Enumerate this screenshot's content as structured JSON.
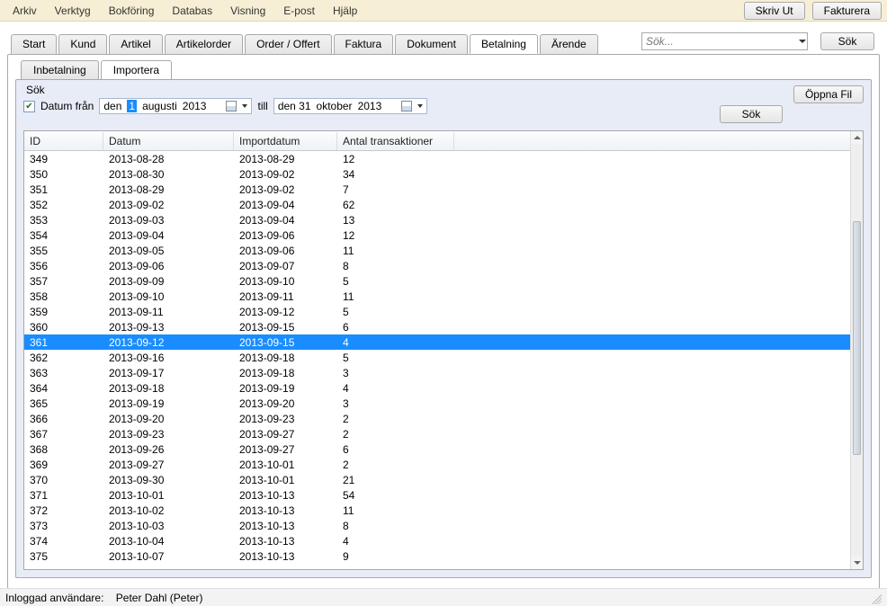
{
  "menu": [
    "Arkiv",
    "Verktyg",
    "Bokföring",
    "Databas",
    "Visning",
    "E-post",
    "Hjälp"
  ],
  "top_buttons": {
    "print": "Skriv Ut",
    "invoice": "Fakturera"
  },
  "search": {
    "placeholder": "Sök...",
    "button": "Sök"
  },
  "main_tabs": [
    "Start",
    "Kund",
    "Artikel",
    "Artikelorder",
    "Order / Offert",
    "Faktura",
    "Dokument",
    "Betalning",
    "Ärende"
  ],
  "main_tab_active": 7,
  "sub_tabs": [
    "Inbetalning",
    "Importera"
  ],
  "sub_tab_active": 1,
  "filter": {
    "title": "Sök",
    "date_from_label": "Datum från",
    "date_from": {
      "day": "den",
      "num": "1",
      "month": "augusti",
      "year": "2013"
    },
    "till_label": "till",
    "date_to": {
      "day": "den 31",
      "month": "oktober",
      "year": "2013"
    },
    "search_btn": "Sök",
    "open_file_btn": "Öppna Fil",
    "checkbox_checked": true
  },
  "columns": [
    "ID",
    "Datum",
    "Importdatum",
    "Antal transaktioner"
  ],
  "selected_row": 12,
  "rows": [
    {
      "id": "349",
      "datum": "2013-08-28",
      "import": "2013-08-29",
      "antal": "12"
    },
    {
      "id": "350",
      "datum": "2013-08-30",
      "import": "2013-09-02",
      "antal": "34"
    },
    {
      "id": "351",
      "datum": "2013-08-29",
      "import": "2013-09-02",
      "antal": "7"
    },
    {
      "id": "352",
      "datum": "2013-09-02",
      "import": "2013-09-04",
      "antal": "62"
    },
    {
      "id": "353",
      "datum": "2013-09-03",
      "import": "2013-09-04",
      "antal": "13"
    },
    {
      "id": "354",
      "datum": "2013-09-04",
      "import": "2013-09-06",
      "antal": "12"
    },
    {
      "id": "355",
      "datum": "2013-09-05",
      "import": "2013-09-06",
      "antal": "11"
    },
    {
      "id": "356",
      "datum": "2013-09-06",
      "import": "2013-09-07",
      "antal": "8"
    },
    {
      "id": "357",
      "datum": "2013-09-09",
      "import": "2013-09-10",
      "antal": "5"
    },
    {
      "id": "358",
      "datum": "2013-09-10",
      "import": "2013-09-11",
      "antal": "11"
    },
    {
      "id": "359",
      "datum": "2013-09-11",
      "import": "2013-09-12",
      "antal": "5"
    },
    {
      "id": "360",
      "datum": "2013-09-13",
      "import": "2013-09-15",
      "antal": "6"
    },
    {
      "id": "361",
      "datum": "2013-09-12",
      "import": "2013-09-15",
      "antal": "4"
    },
    {
      "id": "362",
      "datum": "2013-09-16",
      "import": "2013-09-18",
      "antal": "5"
    },
    {
      "id": "363",
      "datum": "2013-09-17",
      "import": "2013-09-18",
      "antal": "3"
    },
    {
      "id": "364",
      "datum": "2013-09-18",
      "import": "2013-09-19",
      "antal": "4"
    },
    {
      "id": "365",
      "datum": "2013-09-19",
      "import": "2013-09-20",
      "antal": "3"
    },
    {
      "id": "366",
      "datum": "2013-09-20",
      "import": "2013-09-23",
      "antal": "2"
    },
    {
      "id": "367",
      "datum": "2013-09-23",
      "import": "2013-09-27",
      "antal": "2"
    },
    {
      "id": "368",
      "datum": "2013-09-26",
      "import": "2013-09-27",
      "antal": "6"
    },
    {
      "id": "369",
      "datum": "2013-09-27",
      "import": "2013-10-01",
      "antal": "2"
    },
    {
      "id": "370",
      "datum": "2013-09-30",
      "import": "2013-10-01",
      "antal": "21"
    },
    {
      "id": "371",
      "datum": "2013-10-01",
      "import": "2013-10-13",
      "antal": "54"
    },
    {
      "id": "372",
      "datum": "2013-10-02",
      "import": "2013-10-13",
      "antal": "11"
    },
    {
      "id": "373",
      "datum": "2013-10-03",
      "import": "2013-10-13",
      "antal": "8"
    },
    {
      "id": "374",
      "datum": "2013-10-04",
      "import": "2013-10-13",
      "antal": "4"
    },
    {
      "id": "375",
      "datum": "2013-10-07",
      "import": "2013-10-13",
      "antal": "9"
    }
  ],
  "status": {
    "label": "Inloggad användare:",
    "user": "Peter Dahl (Peter)"
  }
}
